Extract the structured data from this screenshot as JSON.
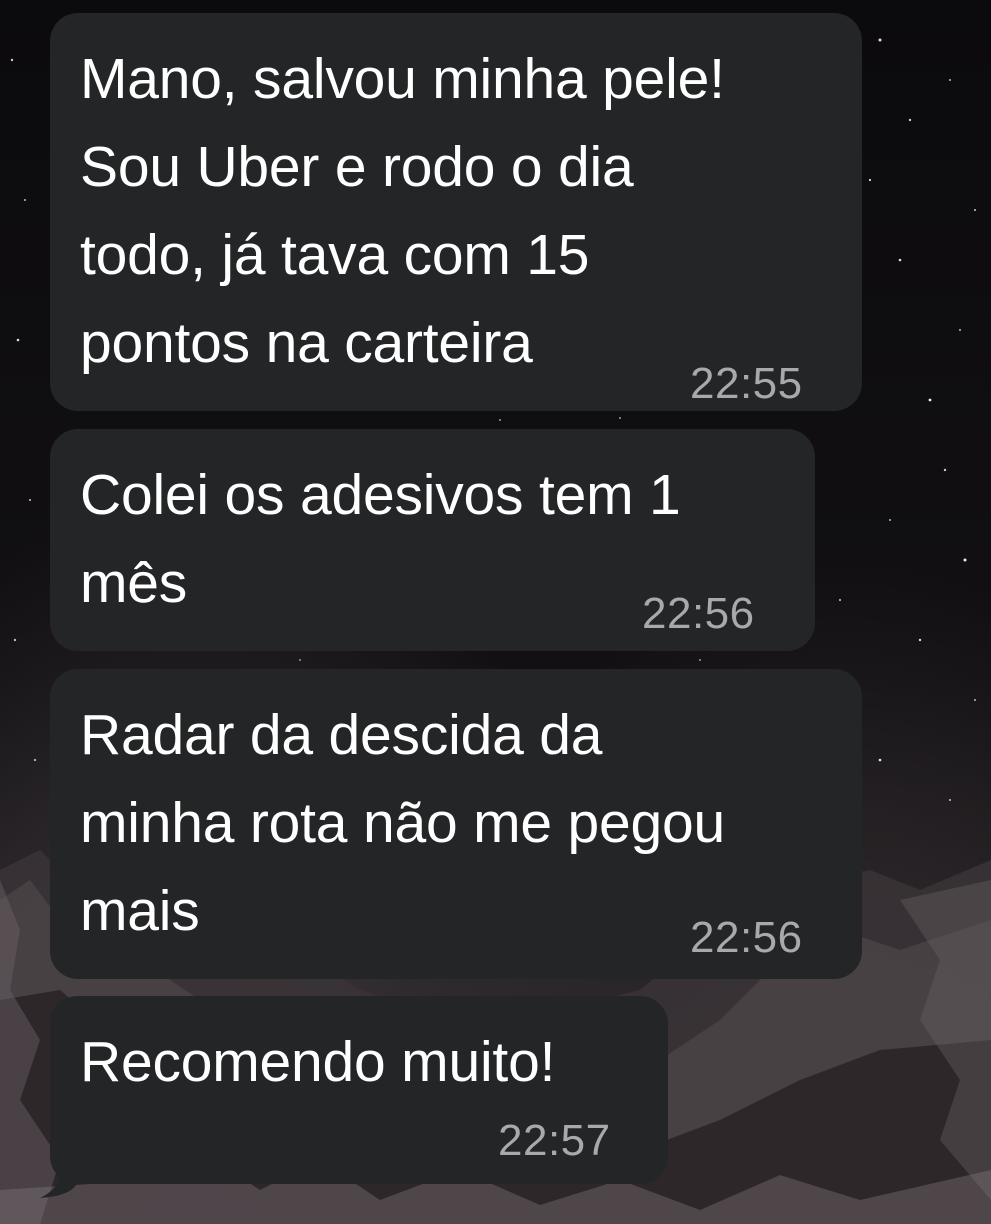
{
  "conversation": {
    "messages": [
      {
        "text": "Mano, salvou minha pele!\nSou Uber e rodo o dia\ntodo, já tava com 15\npontos na carteira",
        "time": "22:55"
      },
      {
        "text": "Colei os adesivos tem 1\nmês",
        "time": "22:56"
      },
      {
        "text": "Radar da descida da\nminha rota não me pegou\nmais",
        "time": "22:56"
      },
      {
        "text": "Recomendo muito!",
        "time": "22:57"
      }
    ]
  },
  "colors": {
    "bubble_background": "#232526",
    "message_text": "#ffffff",
    "timestamp_text": "#a7a9ab",
    "wallpaper": "#0b0a0c"
  }
}
